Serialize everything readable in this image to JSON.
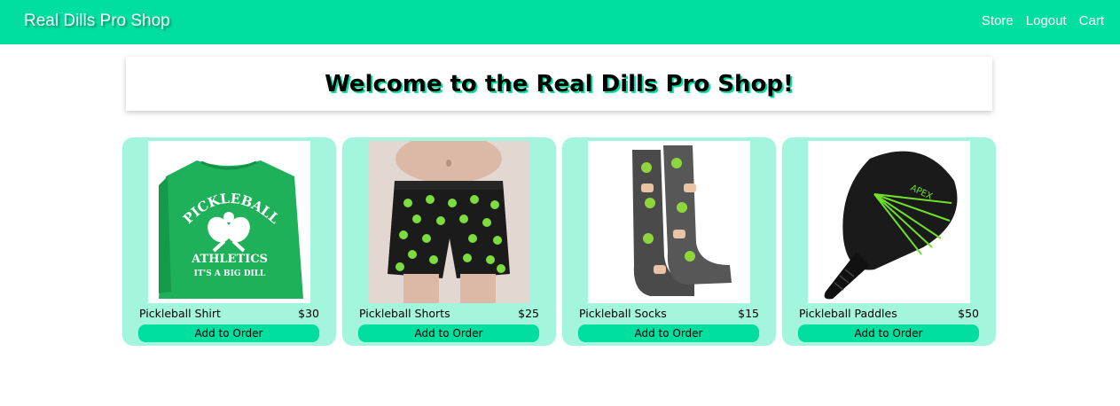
{
  "nav": {
    "brand": "Real Dills Pro Shop",
    "links": [
      "Store",
      "Logout",
      "Cart"
    ]
  },
  "hero": {
    "title": "Welcome to the Real Dills Pro Shop!"
  },
  "products": [
    {
      "name": "Pickleball Shirt",
      "price": "$30",
      "button": "Add to Order",
      "image": "green-tshirt-image",
      "image_text": [
        "PICKLEBALL",
        "ATHLETICS",
        "IT'S A BIG DILL"
      ]
    },
    {
      "name": "Pickleball Shorts",
      "price": "$25",
      "button": "Add to Order",
      "image": "pickleball-shorts-image"
    },
    {
      "name": "Pickleball Socks",
      "price": "$15",
      "button": "Add to Order",
      "image": "pickleball-socks-image"
    },
    {
      "name": "Pickleball Paddles",
      "price": "$50",
      "button": "Add to Order",
      "image": "pickleball-paddle-image",
      "image_text": [
        "APEX"
      ]
    }
  ],
  "colors": {
    "accent": "#00df9f",
    "card_background": "#a3f5dd"
  }
}
